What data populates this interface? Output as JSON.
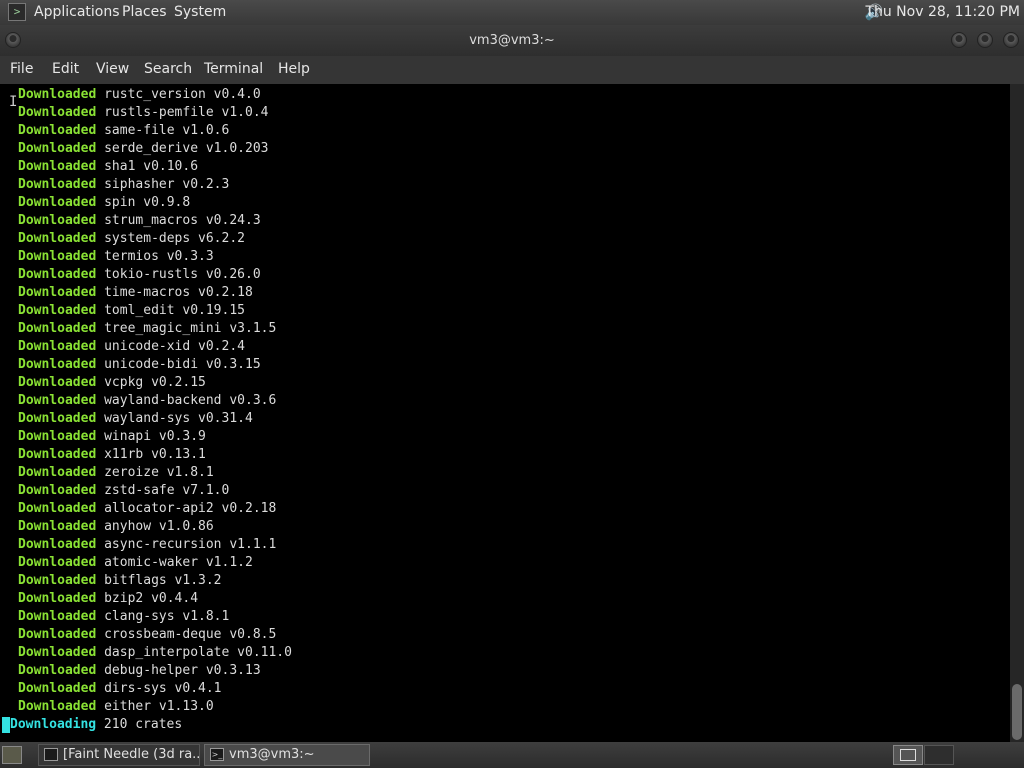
{
  "top_panel": {
    "menus": [
      "Applications",
      "Places",
      "System"
    ],
    "clock": "Thu Nov 28, 11:20 PM",
    "volume_icon": "speaker-icon"
  },
  "window": {
    "title": "vm3@vm3:~"
  },
  "menubar": [
    "File",
    "Edit",
    "View",
    "Search",
    "Terminal",
    "Help"
  ],
  "terminal": {
    "lines": [
      {
        "status": "Downloaded",
        "text": "rustc_version v0.4.0"
      },
      {
        "status": "Downloaded",
        "text": "rustls-pemfile v1.0.4"
      },
      {
        "status": "Downloaded",
        "text": "same-file v1.0.6"
      },
      {
        "status": "Downloaded",
        "text": "serde_derive v1.0.203"
      },
      {
        "status": "Downloaded",
        "text": "sha1 v0.10.6"
      },
      {
        "status": "Downloaded",
        "text": "siphasher v0.2.3"
      },
      {
        "status": "Downloaded",
        "text": "spin v0.9.8"
      },
      {
        "status": "Downloaded",
        "text": "strum_macros v0.24.3"
      },
      {
        "status": "Downloaded",
        "text": "system-deps v6.2.2"
      },
      {
        "status": "Downloaded",
        "text": "termios v0.3.3"
      },
      {
        "status": "Downloaded",
        "text": "tokio-rustls v0.26.0"
      },
      {
        "status": "Downloaded",
        "text": "time-macros v0.2.18"
      },
      {
        "status": "Downloaded",
        "text": "toml_edit v0.19.15"
      },
      {
        "status": "Downloaded",
        "text": "tree_magic_mini v3.1.5"
      },
      {
        "status": "Downloaded",
        "text": "unicode-xid v0.2.4"
      },
      {
        "status": "Downloaded",
        "text": "unicode-bidi v0.3.15"
      },
      {
        "status": "Downloaded",
        "text": "vcpkg v0.2.15"
      },
      {
        "status": "Downloaded",
        "text": "wayland-backend v0.3.6"
      },
      {
        "status": "Downloaded",
        "text": "wayland-sys v0.31.4"
      },
      {
        "status": "Downloaded",
        "text": "winapi v0.3.9"
      },
      {
        "status": "Downloaded",
        "text": "x11rb v0.13.1"
      },
      {
        "status": "Downloaded",
        "text": "zeroize v1.8.1"
      },
      {
        "status": "Downloaded",
        "text": "zstd-safe v7.1.0"
      },
      {
        "status": "Downloaded",
        "text": "allocator-api2 v0.2.18"
      },
      {
        "status": "Downloaded",
        "text": "anyhow v1.0.86"
      },
      {
        "status": "Downloaded",
        "text": "async-recursion v1.1.1"
      },
      {
        "status": "Downloaded",
        "text": "atomic-waker v1.1.2"
      },
      {
        "status": "Downloaded",
        "text": "bitflags v1.3.2"
      },
      {
        "status": "Downloaded",
        "text": "bzip2 v0.4.4"
      },
      {
        "status": "Downloaded",
        "text": "clang-sys v1.8.1"
      },
      {
        "status": "Downloaded",
        "text": "crossbeam-deque v0.8.5"
      },
      {
        "status": "Downloaded",
        "text": "dasp_interpolate v0.11.0"
      },
      {
        "status": "Downloaded",
        "text": "debug-helper v0.3.13"
      },
      {
        "status": "Downloaded",
        "text": "dirs-sys v0.4.1"
      },
      {
        "status": "Downloaded",
        "text": "either v1.13.0"
      }
    ],
    "progress_line": {
      "status": "Downloading",
      "text": "210 crates"
    },
    "colors": {
      "downloaded": "#8ae234",
      "downloading": "#34e2e2",
      "text": "#dcdcdc",
      "background": "#000000"
    }
  },
  "taskbar": {
    "tasks": [
      {
        "label": "[Faint Needle (3d ra...",
        "icon": "app-icon"
      },
      {
        "label": "vm3@vm3:~",
        "icon": "terminal-icon"
      }
    ],
    "show_desktop_icon": "show-desktop-icon",
    "workspace_icon": "workspace-switcher-icon"
  }
}
